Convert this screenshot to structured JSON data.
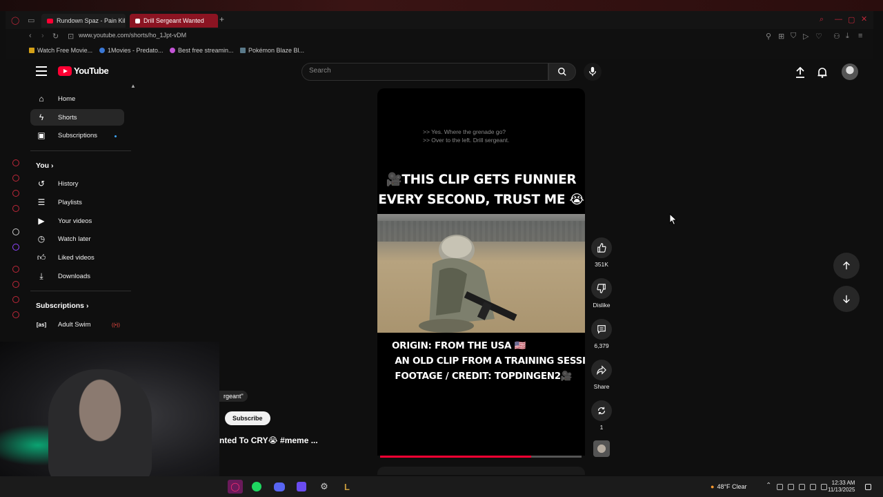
{
  "browser": {
    "tabs": [
      {
        "label": "Rundown Spaz - Pain Kil"
      },
      {
        "label": "Drill Sergeant Wanted"
      }
    ],
    "url": "www.youtube.com/shorts/ho_1Jpt-vDM",
    "bookmarks": [
      {
        "label": "Watch Free Movie..."
      },
      {
        "label": "1Movies - Predato..."
      },
      {
        "label": "Best free streamin..."
      },
      {
        "label": "Pokémon Blaze Bl..."
      }
    ]
  },
  "header": {
    "logo_text": "YouTube",
    "search_placeholder": "Search"
  },
  "sidebar": {
    "main_items": [
      {
        "label": "Home",
        "icon": "home-icon"
      },
      {
        "label": "Shorts",
        "icon": "shorts-icon"
      },
      {
        "label": "Subscriptions",
        "icon": "subscriptions-icon"
      }
    ],
    "you_heading": "You",
    "you_items": [
      {
        "label": "History",
        "icon": "history-icon"
      },
      {
        "label": "Playlists",
        "icon": "playlists-icon"
      },
      {
        "label": "Your videos",
        "icon": "your-videos-icon"
      },
      {
        "label": "Watch later",
        "icon": "watch-later-icon"
      },
      {
        "label": "Liked videos",
        "icon": "liked-icon"
      },
      {
        "label": "Downloads",
        "icon": "download-icon"
      }
    ],
    "subscriptions_heading": "Subscriptions",
    "subscriptions": [
      {
        "label": "Adult Swim"
      }
    ]
  },
  "short": {
    "subtitles": [
      ">> Yes. Where the grenade go?",
      ">> Over to the left. Drill sergeant."
    ],
    "headline_line1": "🎥THIS CLIP GETS FUNNIER",
    "headline_line2": "EVERY SECOND, TRUST ME 😭",
    "caption": "ORIGIN: FROM THE USA 🇺🇸\n AN OLD CLIP FROM A TRAINING SESSION.\n FOOTAGE / CREDIT: TOPDINGEN2🎥",
    "progress": 0.75,
    "channel_fragment": "rgeant\"",
    "subscribe_label": "Subscribe",
    "title_fragment": "nted To CRY😭 #meme ..."
  },
  "actions": {
    "likes": "351K",
    "dislike_label": "Dislike",
    "comments": "6,379",
    "share_label": "Share",
    "remix_count": "1"
  },
  "taskbar": {
    "weather": "48°F  Clear",
    "time": "12:33 AM",
    "date": "11/13/2025"
  },
  "colors": {
    "accent": "#ff0033",
    "background": "#0f0f0f",
    "chip": "#272727"
  }
}
